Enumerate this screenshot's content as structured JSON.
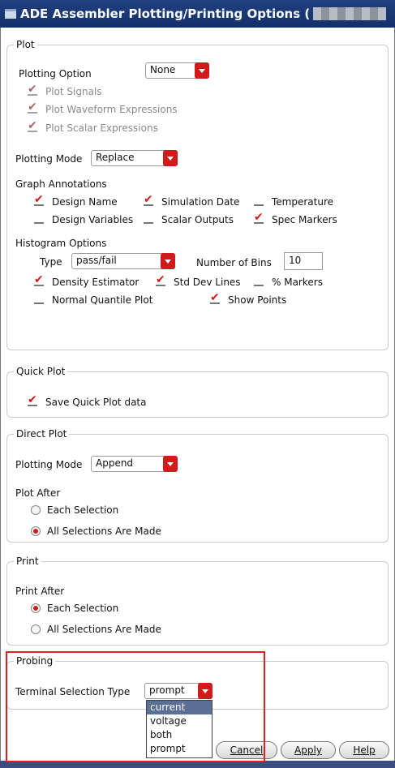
{
  "window": {
    "title": "ADE Assembler Plotting/Printing Options ("
  },
  "plot": {
    "group_title": "Plot",
    "plotting_option_label": "Plotting Option",
    "plotting_option_value": "None",
    "plot_signals_label": "Plot Signals",
    "plot_waveform_label": "Plot Waveform Expressions",
    "plot_scalar_label": "Plot Scalar Expressions",
    "plotting_mode_label": "Plotting Mode",
    "plotting_mode_value": "Replace",
    "graph_annotations_label": "Graph Annotations",
    "annotations": {
      "design_name": "Design Name",
      "simulation_date": "Simulation Date",
      "temperature": "Temperature",
      "design_variables": "Design Variables",
      "scalar_outputs": "Scalar Outputs",
      "spec_markers": "Spec Markers"
    },
    "histogram_label": "Histogram Options",
    "type_label": "Type",
    "type_value": "pass/fail",
    "bins_label": "Number of Bins",
    "bins_value": "10",
    "density_label": "Density Estimator",
    "std_dev_label": "Std Dev Lines",
    "percent_markers_label": "% Markers",
    "normal_quantile_label": "Normal Quantile Plot",
    "show_points_label": "Show Points"
  },
  "quick_plot": {
    "group_title": "Quick Plot",
    "save_label": "Save Quick Plot data"
  },
  "direct_plot": {
    "group_title": "Direct Plot",
    "plotting_mode_label": "Plotting Mode",
    "plotting_mode_value": "Append",
    "plot_after_label": "Plot After",
    "each_selection": "Each Selection",
    "all_selections": "All Selections Are Made"
  },
  "print": {
    "group_title": "Print",
    "print_after_label": "Print After",
    "each_selection": "Each Selection",
    "all_selections": "All Selections Are Made"
  },
  "probing": {
    "group_title": "Probing",
    "terminal_label": "Terminal Selection Type",
    "terminal_value": "prompt",
    "options": [
      "current",
      "voltage",
      "both",
      "prompt"
    ]
  },
  "buttons": {
    "cancel": "Cancel",
    "apply": "Apply",
    "help": "Help"
  },
  "colors": {
    "accent": "#d11a1a",
    "titlebar": "#1b3a78",
    "highlight": "#e01f1f",
    "selection": "#5b6f95"
  }
}
